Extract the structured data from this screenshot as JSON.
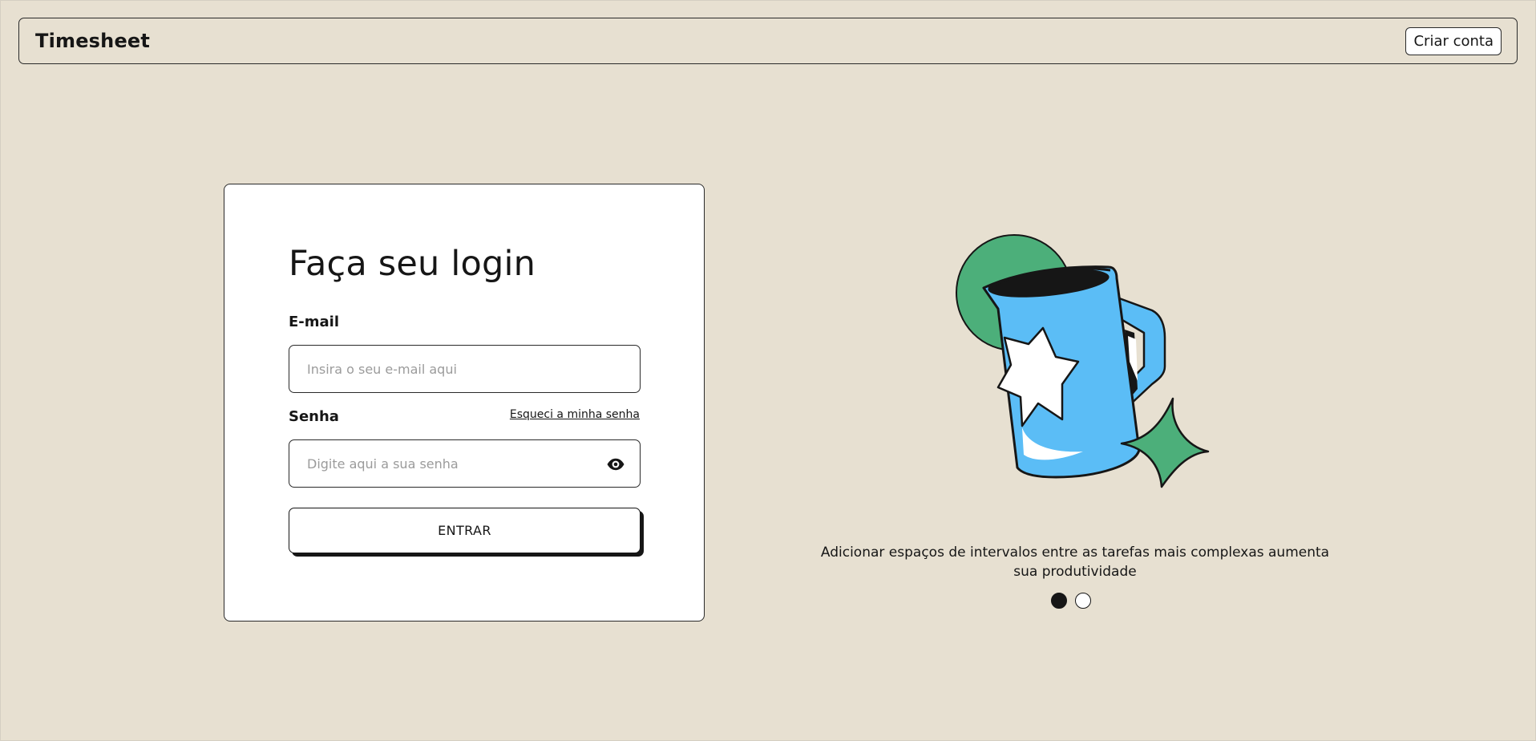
{
  "header": {
    "brand": "Timesheet",
    "create_account_label": "Criar conta"
  },
  "login": {
    "title": "Faça seu login",
    "email_label": "E-mail",
    "email_placeholder": "Insira o seu e-mail aqui",
    "password_label": "Senha",
    "forgot_password_label": "Esqueci a minha senha",
    "password_placeholder": "Digite aqui a sua senha",
    "submit_label": "ENTRAR",
    "password_visibility_icon": "eye-icon"
  },
  "carousel": {
    "tip": "Adicionar espaços de intervalos entre as tarefas mais complexas aumenta sua produtividade",
    "illustration_icon": "mug-with-star-illustration",
    "active_slide": 1,
    "slide_count": 2
  },
  "colors": {
    "background": "#e7e0d1",
    "card": "#ffffff",
    "ink": "#161616",
    "mug_blue": "#5bbdf6",
    "accent_green": "#4caf7a"
  }
}
